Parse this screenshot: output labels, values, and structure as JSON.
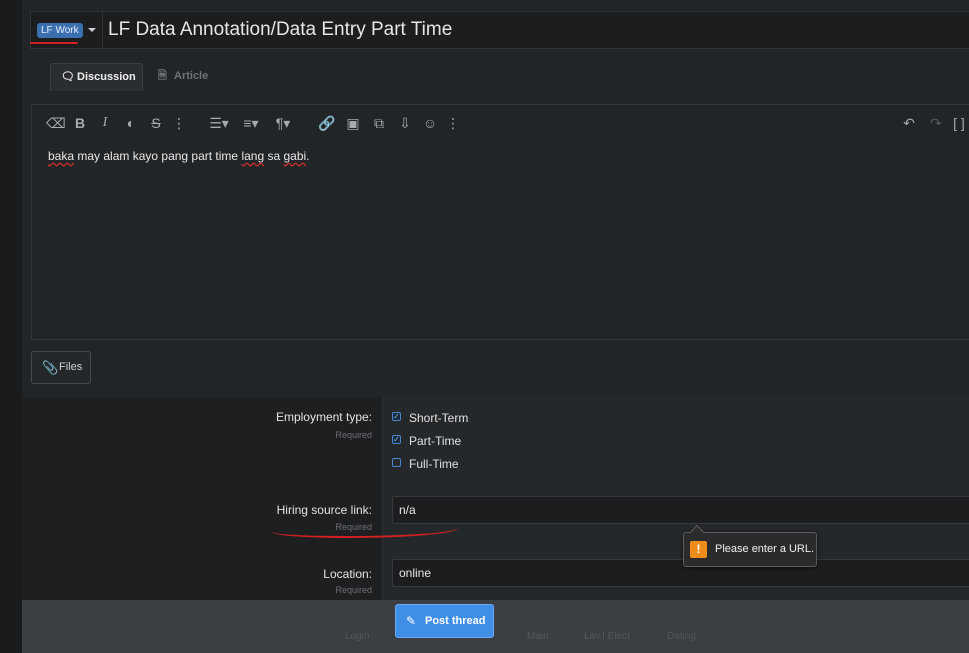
{
  "title_row": {
    "prefix_label": "LF Work",
    "title": "LF Data Annotation/Data Entry Part Time"
  },
  "tabs": [
    {
      "label": "Discussion",
      "icon": "comments-icon",
      "active": true
    },
    {
      "label": "Article",
      "icon": "document-icon",
      "active": false
    }
  ],
  "toolbar": {
    "icons": [
      "eraser-icon",
      "bold-icon",
      "italic-icon",
      "palette-icon",
      "strikethrough-icon",
      "more-icon",
      "list-icon",
      "align-icon",
      "paragraph-icon",
      "link-icon",
      "image-icon",
      "media-icon",
      "insert-icon",
      "emoji-icon",
      "more-icon",
      "undo-icon",
      "redo-icon",
      "bbcode-icon"
    ]
  },
  "editor": {
    "body_parts": [
      "",
      "baka",
      " may alam kayo pang part time ",
      "lang",
      " sa ",
      "gabi",
      "."
    ]
  },
  "files_button": {
    "label": "Files"
  },
  "form": {
    "employment_type": {
      "label": "Employment type:",
      "hint": "Required",
      "options": [
        {
          "label": "Short-Term",
          "checked": true
        },
        {
          "label": "Part-Time",
          "checked": true
        },
        {
          "label": "Full-Time",
          "checked": false
        }
      ]
    },
    "hiring_source": {
      "label": "Hiring source link:",
      "hint": "Required",
      "value": "n/a"
    },
    "location": {
      "label": "Location:",
      "hint": "Required",
      "value": "online"
    }
  },
  "tooltip": {
    "message": "Please enter a URL."
  },
  "footer": {
    "post_label": "Post thread",
    "faint_items": [
      "Login",
      "Main",
      "Lav.I Elect",
      "Dating"
    ]
  },
  "colors": {
    "accent": "#3f8ee8",
    "prefix_badge": "#3c6fb0",
    "annotation_red": "#d42020",
    "warning": "#f08c1a"
  }
}
